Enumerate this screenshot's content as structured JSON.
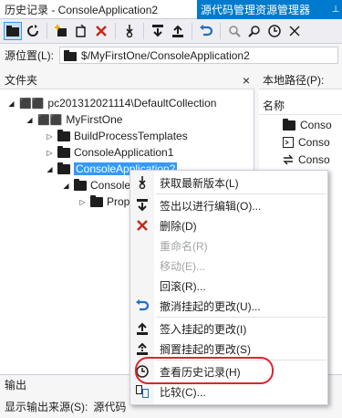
{
  "window": {
    "history_title": "历史记录 - ConsoleApplication2",
    "explorer_title": "源代码管理资源管理器",
    "pin_label": "⊥"
  },
  "toolbar": {
    "icons": [
      "new-folder-icon",
      "refresh-icon",
      "add-items-icon",
      "map-icon",
      "delete-icon",
      "get-latest-icon",
      "checkout-icon",
      "checkin-icon",
      "undo-icon",
      "compare-icon",
      "history-icon",
      "more-icon"
    ]
  },
  "source": {
    "label": "源位置(L):",
    "path": "$/MyFirstOne/ConsoleApplication2"
  },
  "folders_panel": {
    "title": "文件夹",
    "close": "×"
  },
  "tree": {
    "collection": "pc201312021114\\DefaultCollection",
    "project": "MyFirstOne",
    "items": [
      {
        "label": "BuildProcessTemplates"
      },
      {
        "label": "ConsoleApplication1"
      },
      {
        "label": "ConsoleApplication2"
      }
    ],
    "child": "Console",
    "grandchild": "Prop"
  },
  "local_panel": {
    "title": "本地路径(P):",
    "column": "名称",
    "rows": [
      "Conso",
      "Conso",
      "Conso"
    ]
  },
  "output": {
    "title": "输出",
    "show_label": "显示输出来源(S):",
    "source_value": "源代码"
  },
  "context_menu": {
    "items": [
      {
        "label": "获取最新版本(L)",
        "icon": "get-latest-icon",
        "enabled": true
      },
      {
        "label": "签出以进行编辑(O)...",
        "icon": "checkout-icon",
        "enabled": true
      },
      {
        "label": "删除(D)",
        "icon": "delete-icon",
        "enabled": true
      },
      {
        "label": "重命名(R)",
        "icon": "",
        "enabled": false
      },
      {
        "label": "移动(E)...",
        "icon": "",
        "enabled": false
      },
      {
        "label": "回滚(R)...",
        "icon": "",
        "enabled": true
      },
      {
        "label": "撤消挂起的更改(U)...",
        "icon": "undo-icon",
        "enabled": true
      },
      {
        "label": "签入挂起的更改(I)",
        "icon": "checkin-icon",
        "enabled": true
      },
      {
        "label": "搁置挂起的更改(S)",
        "icon": "shelve-icon",
        "enabled": true
      },
      {
        "label": "查看历史记录(H)",
        "icon": "history-icon",
        "enabled": true
      },
      {
        "label": "比较(C)...",
        "icon": "compare-icon",
        "enabled": true
      }
    ]
  },
  "colors": {
    "accent": "#007acc",
    "selection": "#3399ff",
    "delete_red": "#c42b1c",
    "highlight_ring": "#e0242b"
  }
}
